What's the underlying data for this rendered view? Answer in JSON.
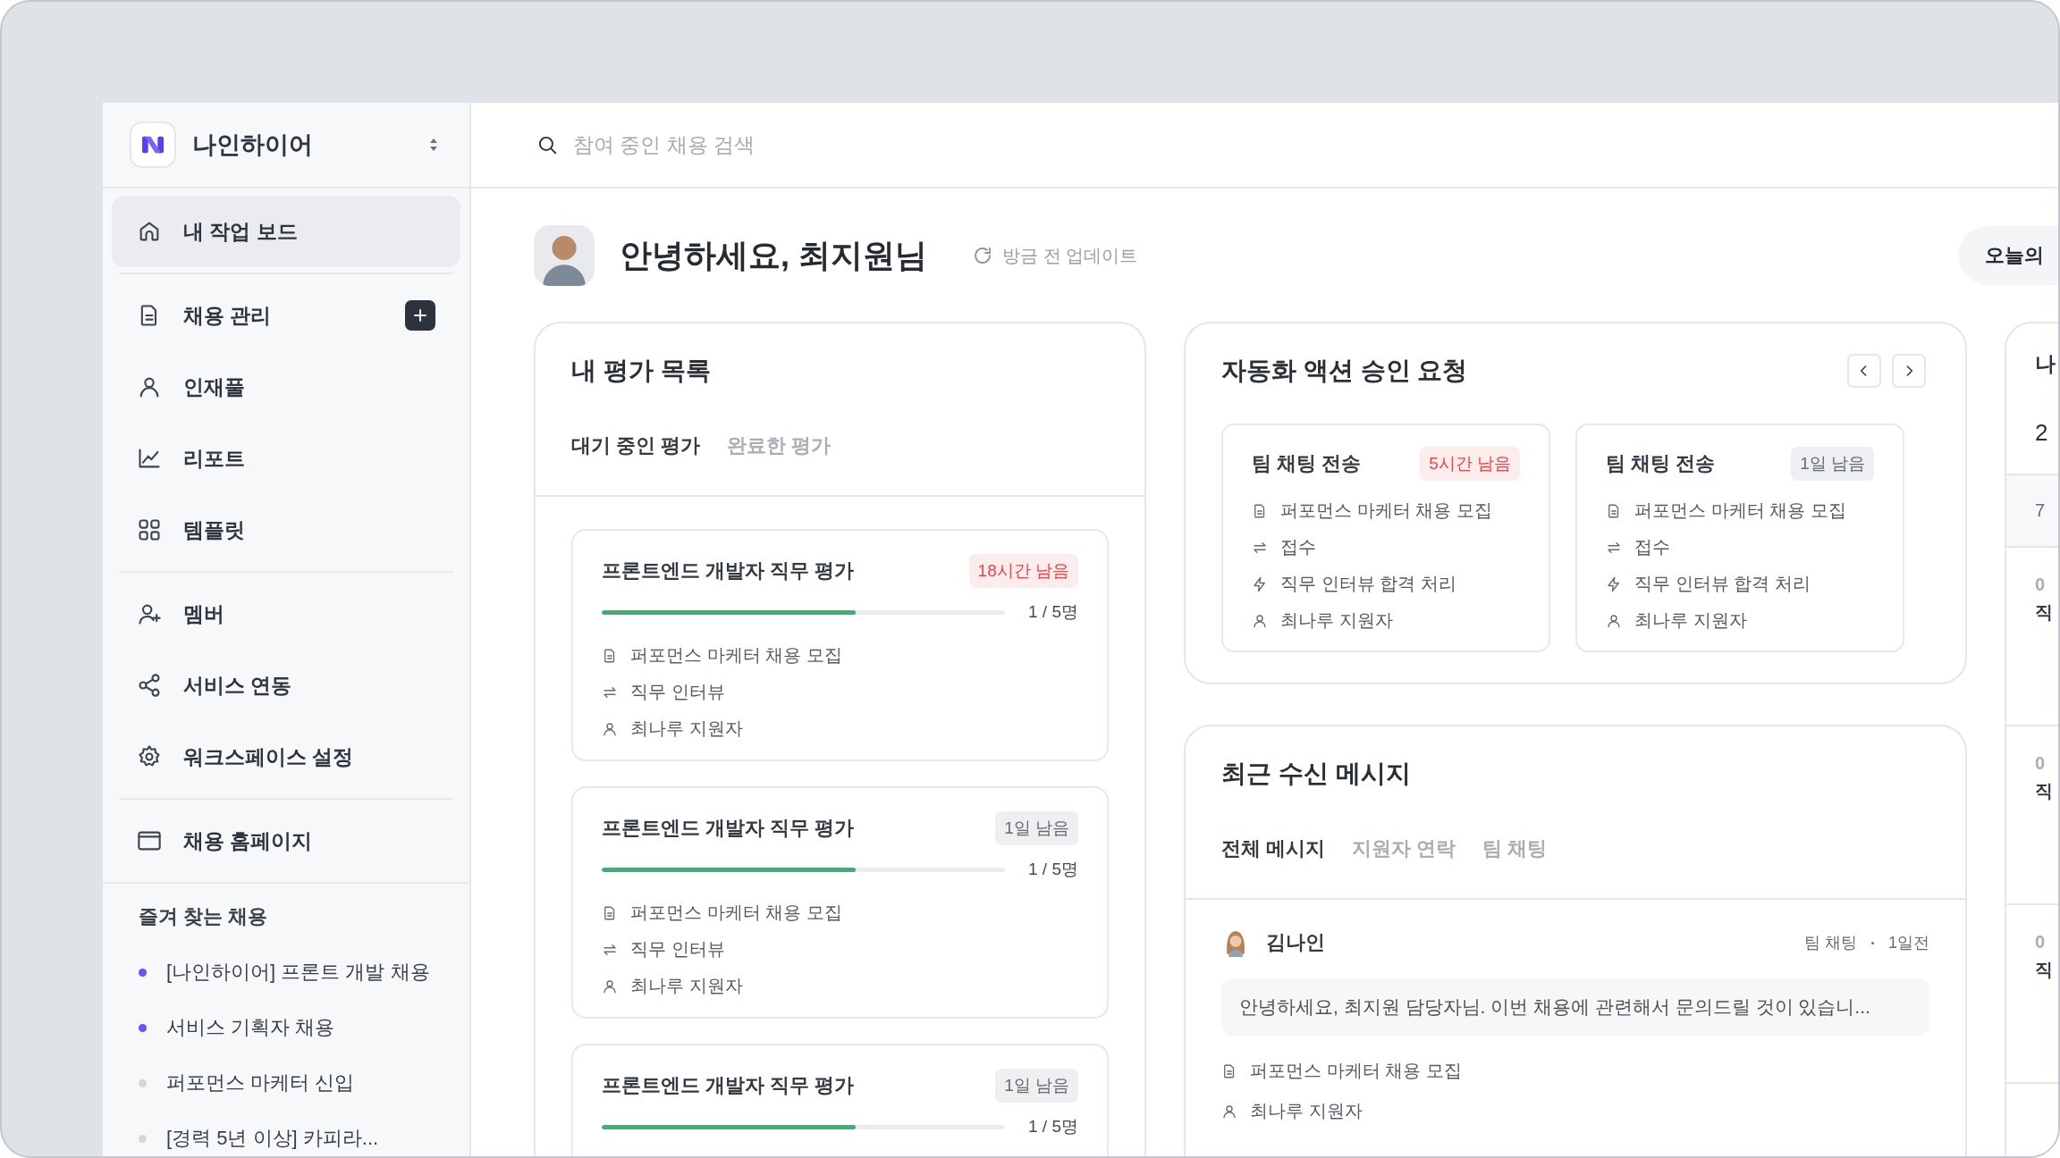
{
  "workspace": {
    "name": "나인하이어"
  },
  "nav_groups": [
    [
      {
        "label": "내 작업 보드",
        "kind": "home",
        "selected": true
      }
    ],
    [
      {
        "label": "채용 관리",
        "kind": "file",
        "selected": false,
        "add_button": true
      },
      {
        "label": "인재풀",
        "kind": "user",
        "selected": false
      },
      {
        "label": "리포트",
        "kind": "chart",
        "selected": false
      },
      {
        "label": "템플릿",
        "kind": "grid",
        "selected": false
      }
    ],
    [
      {
        "label": "멤버",
        "kind": "user-plus",
        "selected": false
      },
      {
        "label": "서비스 연동",
        "kind": "share",
        "selected": false
      },
      {
        "label": "워크스페이스 설정",
        "kind": "gear",
        "selected": false
      }
    ],
    [
      {
        "label": "채용 홈페이지",
        "kind": "browser",
        "selected": false
      }
    ]
  ],
  "favorites": {
    "title": "즐겨 찾는 채용",
    "items": [
      {
        "label": "[나인하이어] 프론트 개발 채용",
        "color": "#6b4eff"
      },
      {
        "label": "서비스 기획자 채용",
        "color": "#6b4eff"
      },
      {
        "label": "퍼포먼스 마케터 신입",
        "color": "#d3d6db"
      },
      {
        "label": "[경력 5년 이상] 카피라...",
        "color": "#d3d6db"
      }
    ]
  },
  "search": {
    "placeholder": "참여 중인 채용 검색"
  },
  "greeting": {
    "title": "안녕하세요, 최지원님",
    "update": "방금 전 업데이트",
    "today_button": "오늘의"
  },
  "evaluations": {
    "title": "내 평가 목록",
    "tabs": [
      {
        "label": "대기 중인 평가",
        "selected": true
      },
      {
        "label": "완료한 평가",
        "selected": false
      }
    ],
    "items": [
      {
        "title": "프론트엔드 개발자 직무 평가",
        "deadline": "18시간 남음",
        "urgent": true,
        "level": 0.63,
        "count": "1 / 5명",
        "details": [
          {
            "kind": "file",
            "text": "퍼포먼스 마케터 채용 모집"
          },
          {
            "kind": "swap",
            "text": "직무 인터뷰"
          },
          {
            "kind": "user",
            "text": "최나루 지원자"
          }
        ]
      },
      {
        "title": "프론트엔드 개발자 직무 평가",
        "deadline": "1일 남음",
        "urgent": false,
        "level": 0.63,
        "count": "1 / 5명",
        "details": [
          {
            "kind": "file",
            "text": "퍼포먼스 마케터 채용 모집"
          },
          {
            "kind": "swap",
            "text": "직무 인터뷰"
          },
          {
            "kind": "user",
            "text": "최나루 지원자"
          }
        ]
      },
      {
        "title": "프론트엔드 개발자 직무 평가",
        "deadline": "1일 남음",
        "urgent": false,
        "level": 0.63,
        "count": "1 / 5명"
      }
    ]
  },
  "approvals": {
    "title": "자동화 액션 승인 요청",
    "items": [
      {
        "title": "팀 채팅 전송",
        "deadline": "5시간 남음",
        "urgent": true,
        "details": [
          {
            "kind": "file",
            "text": "퍼포먼스 마케터 채용 모집"
          },
          {
            "kind": "swap",
            "text": "접수"
          },
          {
            "kind": "bolt",
            "text": "직무 인터뷰 합격 처리"
          },
          {
            "kind": "user",
            "text": "최나루 지원자"
          }
        ]
      },
      {
        "title": "팀 채팅 전송",
        "deadline": "1일 남음",
        "urgent": false,
        "details": [
          {
            "kind": "file",
            "text": "퍼포먼스 마케터 채용 모집"
          },
          {
            "kind": "swap",
            "text": "접수"
          },
          {
            "kind": "bolt",
            "text": "직무 인터뷰 합격 처리"
          },
          {
            "kind": "user",
            "text": "최나루 지원자"
          }
        ]
      }
    ]
  },
  "messages": {
    "title": "최근 수신 메시지",
    "tabs": [
      {
        "label": "전체 메시지",
        "selected": true
      },
      {
        "label": "지원자 연락",
        "selected": false
      },
      {
        "label": "팀 채팅",
        "selected": false
      }
    ],
    "items": [
      {
        "sender": "김나인",
        "channel": "팀 채팅",
        "time": "1일전",
        "preview": "안녕하세요, 최지원 담당자님. 이번 채용에 관련해서 문의드릴 것이 있습니...",
        "details": [
          {
            "kind": "file",
            "text": "퍼포먼스 마케터 채용 모집"
          },
          {
            "kind": "user",
            "text": "최나루 지원자"
          }
        ]
      }
    ]
  },
  "side_card": {
    "title": "나",
    "lines": [
      "2",
      "7"
    ],
    "entries": [
      {
        "time": "0",
        "title": "직"
      },
      {
        "time": "0",
        "title": "직"
      },
      {
        "time": "0",
        "title": "직"
      }
    ]
  }
}
